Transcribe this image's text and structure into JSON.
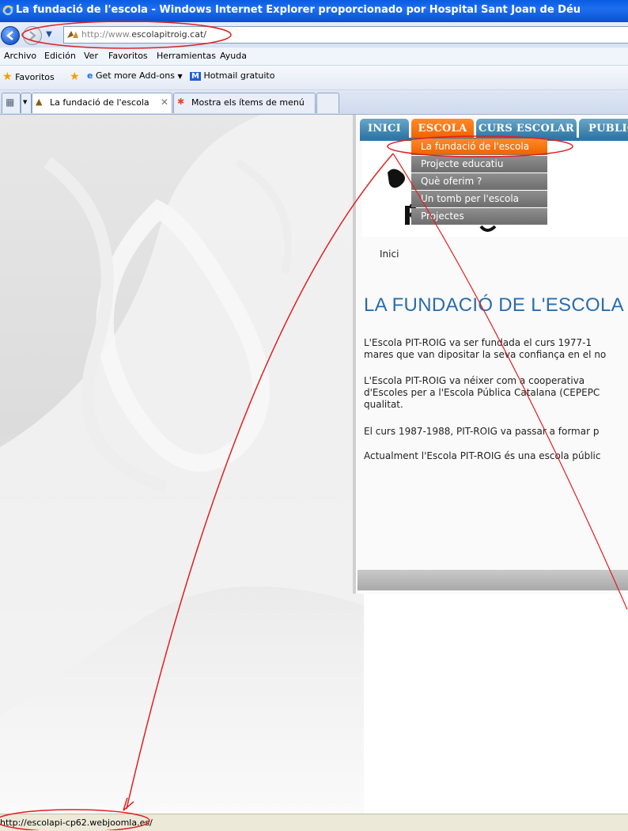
{
  "window": {
    "title": "La fundació de l'escola - Windows Internet Explorer proporcionado por Hospital Sant Joan de Déu"
  },
  "address": {
    "url_prefix": "http://www.",
    "url_domain": "escolapitroig.cat/"
  },
  "menu": [
    "Archivo",
    "Edición",
    "Ver",
    "Favoritos",
    "Herramientas",
    "Ayuda"
  ],
  "favorites_bar": {
    "favorites": "Favoritos",
    "addons": "Get more Add-ons",
    "hotmail": "Hotmail gratuito"
  },
  "browser_tabs": [
    {
      "label": "La fundació de l'escola",
      "active": true
    },
    {
      "label": "Mostra els ítems de menú",
      "active": false
    }
  ],
  "site": {
    "nav": [
      "INICI",
      "ESCOLA",
      "CURS ESCOLAR",
      "PUBLIC"
    ],
    "active_nav": "ESCOLA",
    "dropdown": [
      "La fundació de l'escola",
      "Projecte educatiu",
      "Què oferim ?",
      "Un tomb per l'escola",
      "Projectes"
    ],
    "breadcrumb": "Inici",
    "heading": "LA FUNDACIÓ DE L'ESCOLA",
    "paragraphs": [
      [
        "L'Escola PIT-ROIG va ser fundada el curs 1977-1",
        "mares que van dipositar la seva confiança en el no"
      ],
      [
        "L'Escola PIT-ROIG va néixer com  a cooperativa",
        "d'Escoles per a l'Escola Pública Catalana (CEPEPC",
        "qualitat."
      ],
      [
        "El curs 1987-1988, PIT-ROIG va passar a formar p"
      ],
      [
        "Actualment l'Escola PIT-ROIG és una escola públic"
      ]
    ]
  },
  "status": {
    "text": "http://escolapi-cp62.webjoomla.es/"
  },
  "colors": {
    "annotation": "#e02020",
    "nav_active": "#f06400",
    "nav_inactive": "#2f77a6",
    "heading": "#2b6cab"
  }
}
